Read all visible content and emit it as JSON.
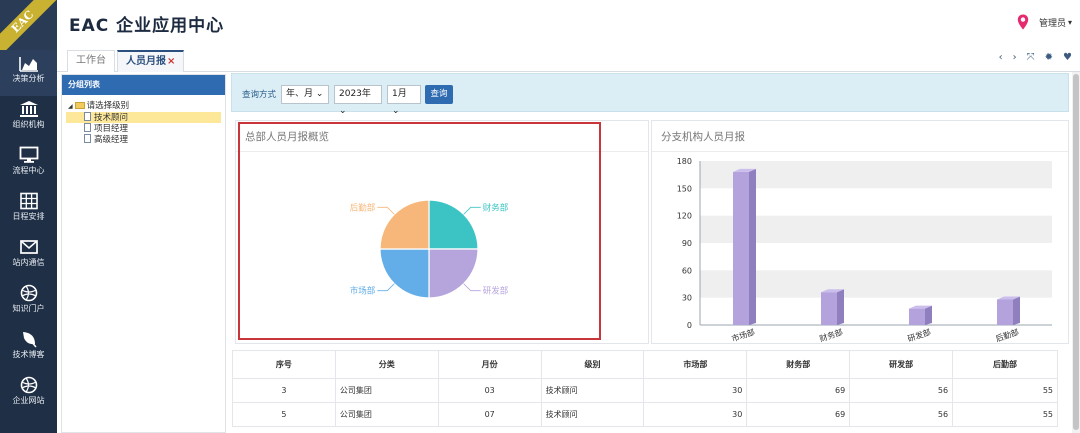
{
  "app": {
    "logo_text": "EAC",
    "title": "EAC 企业应用中心",
    "user": "管理员"
  },
  "nav": [
    {
      "label": "决策分析",
      "icon": "area-chart-icon"
    },
    {
      "label": "组织机构",
      "icon": "bank-icon"
    },
    {
      "label": "流程中心",
      "icon": "monitor-icon"
    },
    {
      "label": "日程安排",
      "icon": "calendar-grid-icon"
    },
    {
      "label": "站内通信",
      "icon": "envelope-icon"
    },
    {
      "label": "知识门户",
      "icon": "globe-icon"
    },
    {
      "label": "技术博客",
      "icon": "leaf-icon"
    },
    {
      "label": "企业网站",
      "icon": "globe-icon"
    }
  ],
  "tabs": [
    {
      "label": "工作台"
    },
    {
      "label": "人员月报",
      "close": "×"
    }
  ],
  "group_panel": {
    "title": "分组列表",
    "root": "请选择级别",
    "items": [
      "技术顾问",
      "项目经理",
      "高级经理"
    ]
  },
  "query": {
    "label": "查询方式",
    "mode": "年、月",
    "year": "2023年",
    "month": "1月",
    "button": "查询"
  },
  "colors": {
    "accent": "#2e6bb1",
    "finance": "#3cc4c4",
    "rnd": "#b6a4dd",
    "market": "#63aee8",
    "logistics": "#f8b77a",
    "bar": "#b3a2dc"
  },
  "chart_data": [
    {
      "type": "pie",
      "title": "总部人员月报概览",
      "categories": [
        "财务部",
        "研发部",
        "市场部",
        "后勤部"
      ],
      "values": [
        25,
        25,
        25,
        25
      ]
    },
    {
      "type": "bar",
      "title": "分支机构人员月报",
      "categories": [
        "市场部",
        "财务部",
        "研发部",
        "后勤部"
      ],
      "values": [
        168,
        36,
        18,
        28
      ],
      "ylim": [
        0,
        180
      ],
      "yticks": [
        0,
        30,
        60,
        90,
        120,
        150,
        180
      ]
    }
  ],
  "table": {
    "headers": [
      "序号",
      "分类",
      "月份",
      "级别",
      "市场部",
      "财务部",
      "研发部",
      "后勤部"
    ],
    "rows": [
      [
        "3",
        "公司集团",
        "03",
        "技术顾问",
        "30",
        "69",
        "56",
        "55"
      ],
      [
        "5",
        "公司集团",
        "07",
        "技术顾问",
        "30",
        "69",
        "56",
        "55"
      ]
    ]
  }
}
